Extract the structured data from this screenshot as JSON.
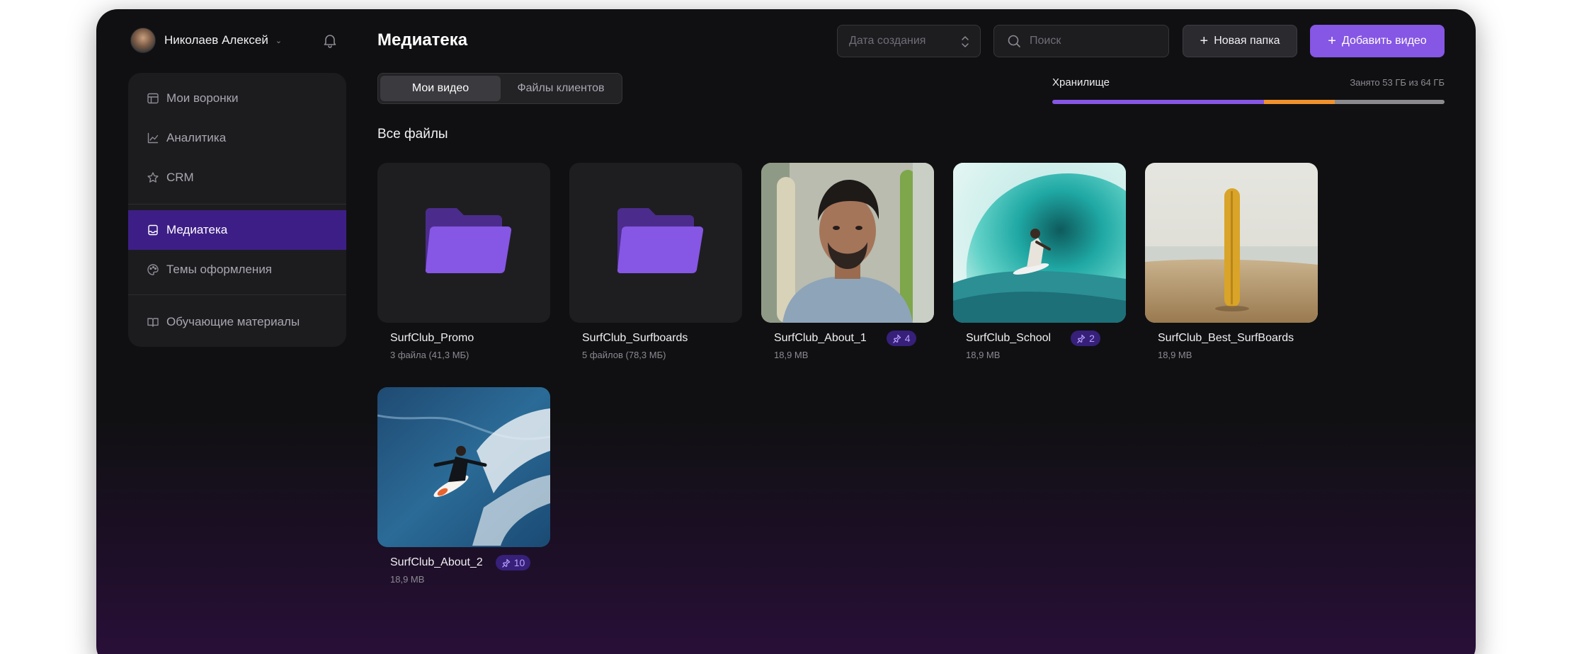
{
  "user": {
    "name": "Николаев Алексей"
  },
  "sidebar": {
    "items": [
      {
        "label": "Мои воронки",
        "icon": "table-icon"
      },
      {
        "label": "Аналитика",
        "icon": "chart-line-icon"
      },
      {
        "label": "CRM",
        "icon": "star-icon"
      },
      {
        "label": "Медиатека",
        "icon": "inbox-icon",
        "active": true
      },
      {
        "label": "Темы оформления",
        "icon": "palette-icon"
      },
      {
        "label": "Обучающие материалы",
        "icon": "book-icon"
      }
    ]
  },
  "header": {
    "title": "Медиатека",
    "sort_placeholder": "Дата создания",
    "search_placeholder": "Поиск",
    "new_folder_label": "Новая папка",
    "add_video_label": "Добавить видео"
  },
  "tabs": [
    {
      "label": "Мои видео",
      "active": true
    },
    {
      "label": "Файлы клиентов",
      "active": false
    }
  ],
  "storage": {
    "label": "Хранилище",
    "usage_text": "Занято 53 ГБ из 64 ГБ",
    "segments": [
      {
        "fraction": 0.54,
        "color": "#8656e4"
      },
      {
        "fraction": 0.18,
        "color": "#f0922e"
      },
      {
        "fraction": 0.28,
        "color": "#8a8a8f"
      }
    ]
  },
  "section_title": "Все файлы",
  "files": [
    {
      "name": "SurfClub_Promo",
      "meta": "3 файла (41,3 МБ)",
      "type": "folder"
    },
    {
      "name": "SurfClub_Surfboards",
      "meta": "5 файлов (78,3 МБ)",
      "type": "folder"
    },
    {
      "name": "SurfClub_About_1",
      "meta": "18,9 MB",
      "type": "video",
      "pins": "4"
    },
    {
      "name": "SurfClub_School",
      "meta": "18,9 MB",
      "type": "video",
      "pins": "2"
    },
    {
      "name": "SurfClub_Best_SurfBoards",
      "meta": "18,9 MB",
      "type": "video"
    },
    {
      "name": "SurfClub_About_2",
      "meta": "18,9 MB",
      "type": "video",
      "pins": "10"
    }
  ],
  "colors": {
    "accent": "#8656e4",
    "sidebar_active": "#3d1e86",
    "badge_bg": "#36207a",
    "badge_text": "#b9a2ff"
  }
}
